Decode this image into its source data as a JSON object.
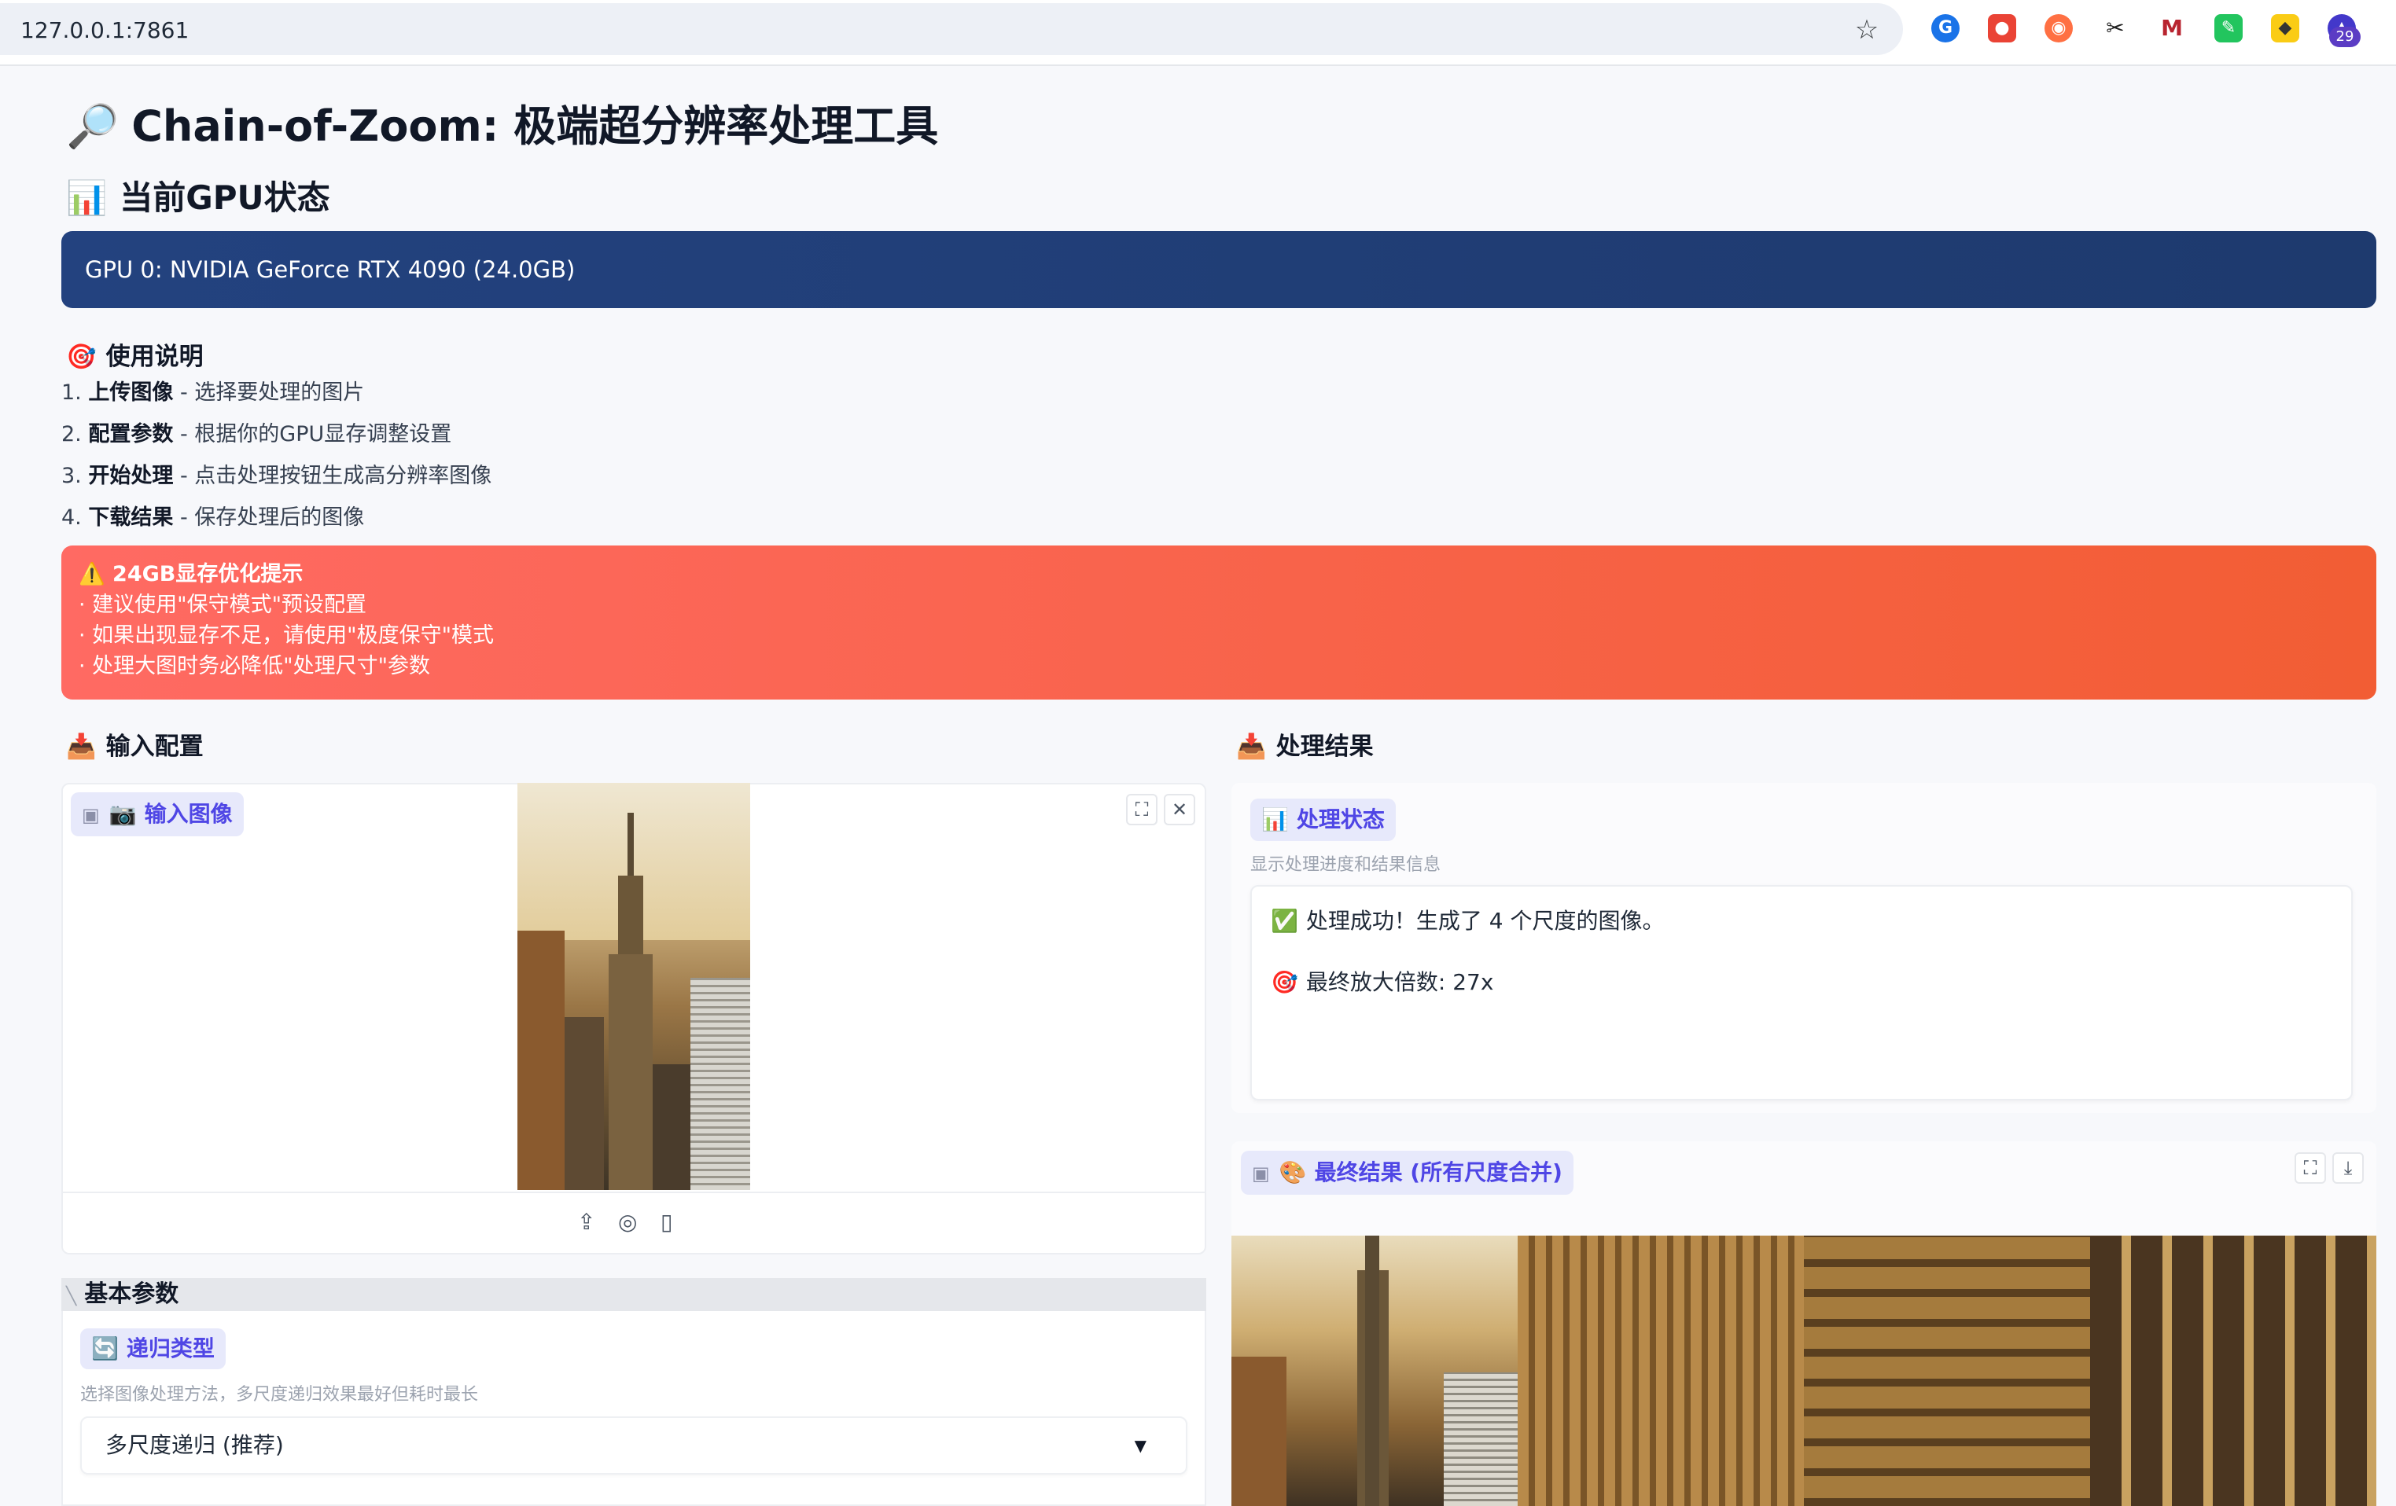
{
  "browser": {
    "url": "127.0.0.1:7861",
    "extension_badge": "29"
  },
  "page": {
    "title": "Chain-of-Zoom: 极端超分辨率处理工具",
    "gpu_heading": "当前GPU状态",
    "gpu_info": "GPU 0: NVIDIA GeForce RTX 4090 (24.0GB)"
  },
  "instructions": {
    "heading": "使用说明",
    "steps": [
      {
        "num": "1.",
        "bold": "上传图像",
        "text": " - 选择要处理的图片"
      },
      {
        "num": "2.",
        "bold": "配置参数",
        "text": " - 根据你的GPU显存调整设置"
      },
      {
        "num": "3.",
        "bold": "开始处理",
        "text": " - 点击处理按钮生成高分辨率图像"
      },
      {
        "num": "4.",
        "bold": "下载结果",
        "text": " - 保存处理后的图像"
      }
    ]
  },
  "warning": {
    "title": "24GB显存优化提示",
    "lines": [
      "· 建议使用\"保守模式\"预设配置",
      "· 如果出现显存不足，请使用\"极度保守\"模式",
      "· 处理大图时务必降低\"处理尺寸\"参数"
    ]
  },
  "input": {
    "heading": "输入配置",
    "image_label": "输入图像",
    "params_heading": "基本参数",
    "recursion_label": "递归类型",
    "recursion_hint": "选择图像处理方法，多尺度递归效果最好但耗时最长",
    "recursion_value": "多尺度递归 (推荐)"
  },
  "output": {
    "heading": "处理结果",
    "status_label": "处理状态",
    "status_hint": "显示处理进度和结果信息",
    "status_success": "处理成功！生成了 4 个尺度的图像。",
    "status_scale": "最终放大倍数: 27x",
    "final_label": "最终结果 (所有尺度合并)"
  },
  "icons": {
    "magnifier": "magnifier-icon",
    "chart": "bar-chart-icon",
    "target": "target-icon",
    "warning": "warning-icon",
    "inbox": "inbox-icon",
    "camera": "camera-icon",
    "refresh": "refresh-icon",
    "check": "check-icon",
    "palette": "palette-icon"
  }
}
